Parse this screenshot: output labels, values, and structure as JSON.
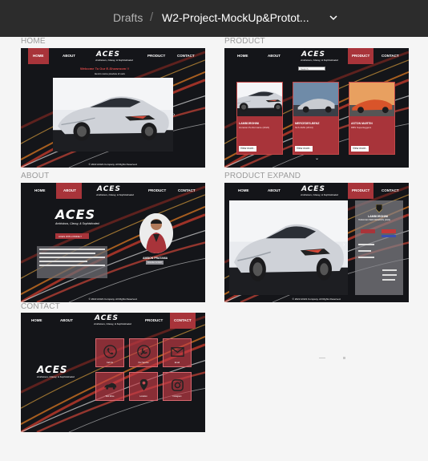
{
  "breadcrumb": {
    "drafts": "Drafts",
    "separator": "/",
    "file": "W2-Project-MockUp&Protot..."
  },
  "frames": {
    "home_label": "HOME",
    "product_label": "PRODUCT",
    "about_label": "ABOUT",
    "product_expand_label": "PRODUCT EXPAND",
    "contact_label": "CONTACT"
  },
  "nav": {
    "home": "HOME",
    "about": "ABOUT",
    "product": "PRODUCT",
    "contact": "CONTACT"
  },
  "brand": {
    "logo": "ACES",
    "tagline": "Ambisious, Classy, & Sophisticated"
  },
  "home": {
    "welcome": "Welcome To Our E-Showroom !!",
    "subtitle": "Here's some preview of ours",
    "footer": "© 2022 ACES Company. All Rights Reserved."
  },
  "product": {
    "search_placeholder": "Search",
    "cards": [
      {
        "name": "LAMBORGHINI",
        "sub": "Huracan Performante (2022)",
        "button": "View more.."
      },
      {
        "name": "MERCEDES-BENZ",
        "sub": "SLS AMG (2014)",
        "button": "View more.."
      },
      {
        "name": "ASTON MARTIN",
        "sub": "DBS Superleggera",
        "button": "View more.."
      }
    ]
  },
  "about": {
    "cta": "ACES WITH PRIDE !!",
    "person_name": "AMBON PRATAMA",
    "person_role": "Founder & CEO",
    "footer": "© 2022 ACES Company. All Rights Reserved."
  },
  "expand": {
    "title": "LAMBORGHINI",
    "subtitle": "HURACAN PERFORMANTE (2022)",
    "footer": "© 2022 ACES Company. All Rights Reserved."
  },
  "contact": {
    "items": [
      "Call Us",
      "Our Service",
      "Email",
      "Test Drive",
      "Location",
      "Instagram"
    ]
  },
  "colors": {
    "accent": "#a8343a",
    "topbar": "#2c2c2c",
    "frame_bg": "#16171b"
  }
}
